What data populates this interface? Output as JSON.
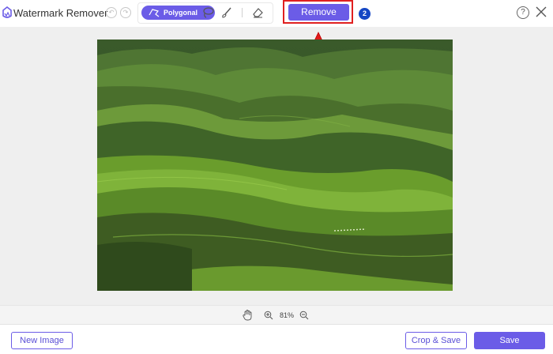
{
  "app": {
    "title": "Watermark Remover"
  },
  "toolbar": {
    "polygonal_label": "Polygonal",
    "remove_label": "Remove",
    "step_badge": "2",
    "help_label": "?"
  },
  "zoom": {
    "value": "81%"
  },
  "footer": {
    "new_image_label": "New Image",
    "crop_save_label": "Crop & Save",
    "save_label": "Save"
  },
  "colors": {
    "accent": "#6b5ce7",
    "highlight": "#e02020",
    "badge": "#1547c4"
  },
  "icons": [
    "app-logo-icon",
    "undo-icon",
    "redo-icon",
    "polygon-icon",
    "lasso-icon",
    "brush-icon",
    "eraser-icon",
    "help-icon",
    "close-icon",
    "hand-icon",
    "zoom-in-icon",
    "zoom-out-icon",
    "arrow-up-icon"
  ]
}
